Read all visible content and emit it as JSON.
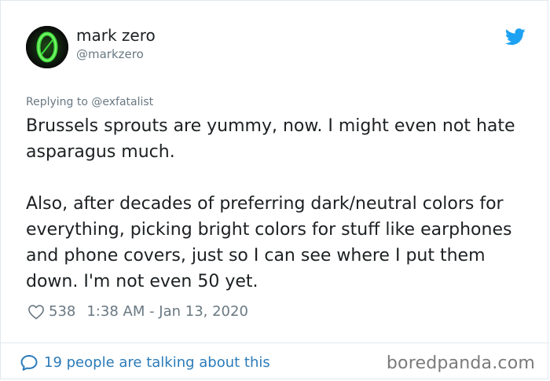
{
  "author": {
    "display_name": "mark zero",
    "handle": "@markzero",
    "avatar_icon": "green-zero-avatar"
  },
  "brand_icon": "twitter-bird-icon",
  "reply": {
    "text": "Replying to @exfatalist"
  },
  "tweet": {
    "paragraphs": [
      "Brussels sprouts are yummy, now. I might even not hate asparagus much.",
      "Also, after decades of preferring dark/neutral colors for everything, picking bright colors for stuff like earphones and phone covers, just so I can see where I put them down. I'm not even 50 yet."
    ]
  },
  "meta": {
    "likes": "538",
    "timestamp": "1:38 AM - Jan 13, 2020"
  },
  "footer": {
    "conversation": "19 people are talking about this",
    "watermark": "boredpanda.com"
  },
  "colors": {
    "text": "#1c2022",
    "secondary": "#697882",
    "link": "#2b7bb9",
    "twitter_blue": "#1da1f2",
    "avatar_green": "#3ddc3a"
  }
}
